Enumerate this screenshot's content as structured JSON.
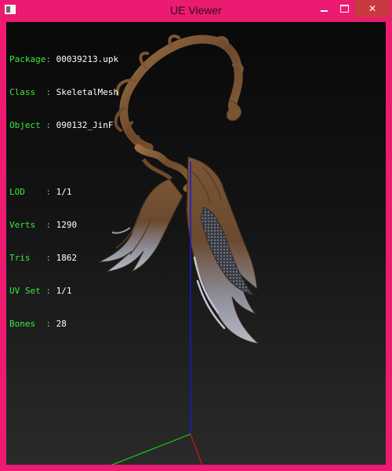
{
  "window": {
    "title": "UE Viewer",
    "controls": {
      "minimize": "minimize",
      "maximize": "maximize",
      "close": "close"
    },
    "frame_color": "#ec1a70",
    "close_color": "#c83a3f"
  },
  "info": {
    "package": {
      "label": "Package:",
      "value": "00039213.upk"
    },
    "class": {
      "label": "Class  :",
      "value": "SkeletalMesh"
    },
    "object": {
      "label": "Object :",
      "value": "090132_JinF"
    },
    "lod": {
      "label": "LOD    :",
      "value": "1/1"
    },
    "verts": {
      "label": "Verts  :",
      "value": "1290"
    },
    "tris": {
      "label": "Tris   :",
      "value": "1862"
    },
    "uvset": {
      "label": "UV Set :",
      "value": "1/1"
    },
    "bones": {
      "label": "Bones  :",
      "value": "28"
    }
  },
  "colors": {
    "label": "#3de83d",
    "axis_x": "#d01818",
    "axis_y": "#18d018",
    "axis_z": "#1818d8",
    "wood": "#7a5534",
    "feather": "#8d8f9c"
  }
}
